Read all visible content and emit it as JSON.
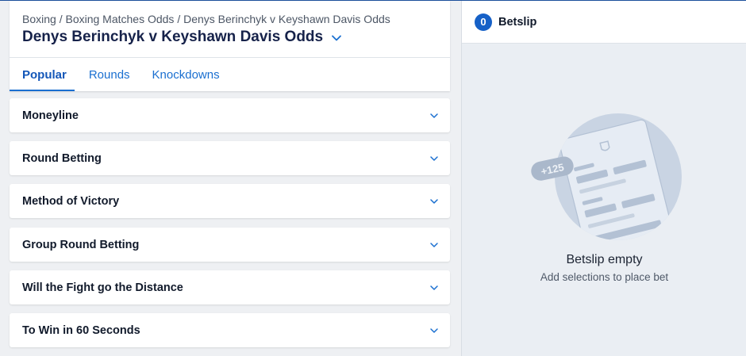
{
  "breadcrumb": "Boxing / Boxing Matches Odds / Denys Berinchyk v Keyshawn Davis Odds",
  "page_title": "Denys Berinchyk v Keyshawn Davis Odds",
  "tabs": [
    {
      "label": "Popular",
      "active": true
    },
    {
      "label": "Rounds",
      "active": false
    },
    {
      "label": "Knockdowns",
      "active": false
    }
  ],
  "markets": [
    {
      "label": "Moneyline"
    },
    {
      "label": "Round Betting"
    },
    {
      "label": "Method of Victory"
    },
    {
      "label": "Group Round Betting"
    },
    {
      "label": "Will the Fight go the Distance"
    },
    {
      "label": "To Win in 60 Seconds"
    }
  ],
  "betslip": {
    "count": "0",
    "title": "Betslip",
    "empty_title": "Betslip empty",
    "empty_subtitle": "Add selections to place bet",
    "illustration_odds": "+125"
  },
  "colors": {
    "accent": "#1a6fd0",
    "title": "#16224a",
    "badge": "#1661c7"
  }
}
